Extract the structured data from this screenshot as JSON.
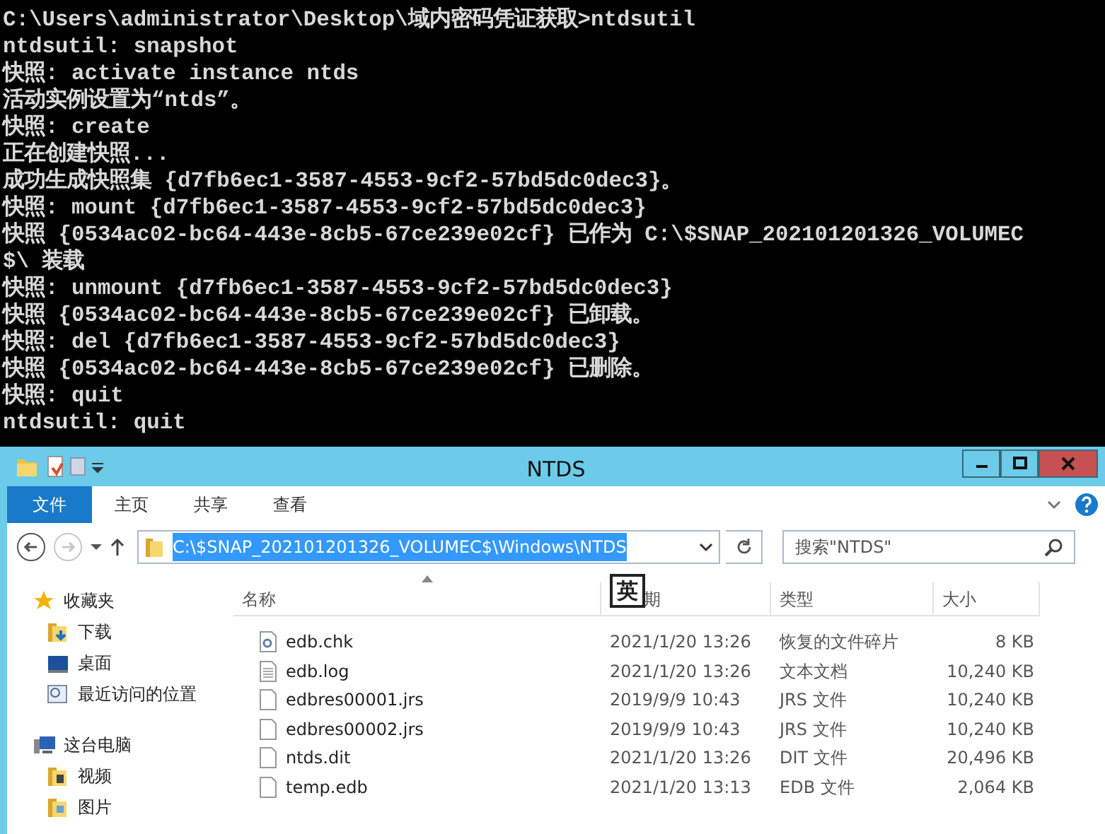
{
  "console": {
    "lines": [
      "C:\\Users\\administrator\\Desktop\\域内密码凭证获取>ntdsutil",
      "ntdsutil: snapshot",
      "快照: activate instance ntds",
      "活动实例设置为“ntds”。",
      "快照: create",
      "正在创建快照...",
      "成功生成快照集 {d7fb6ec1-3587-4553-9cf2-57bd5dc0dec3}。",
      "快照: mount {d7fb6ec1-3587-4553-9cf2-57bd5dc0dec3}",
      "快照 {0534ac02-bc64-443e-8cb5-67ce239e02cf} 已作为 C:\\$SNAP_202101201326_VOLUMEC",
      "$\\ 装载",
      "快照: unmount {d7fb6ec1-3587-4553-9cf2-57bd5dc0dec3}",
      "快照 {0534ac02-bc64-443e-8cb5-67ce239e02cf} 已卸载。",
      "快照: del {d7fb6ec1-3587-4553-9cf2-57bd5dc0dec3}",
      "快照 {0534ac02-bc64-443e-8cb5-67ce239e02cf} 已删除。",
      "快照: quit",
      "ntdsutil: quit"
    ]
  },
  "explorer": {
    "title": "NTDS",
    "ribbon_tabs": [
      {
        "label": "文件",
        "kind": "menu"
      },
      {
        "label": "主页",
        "kind": "tab"
      },
      {
        "label": "共享",
        "kind": "tab"
      },
      {
        "label": "查看",
        "kind": "tab"
      }
    ],
    "back": {
      "disabled": false
    },
    "forward": {
      "disabled": true
    },
    "address": {
      "path": "C:\\$SNAP_202101201326_VOLUMEC$\\Windows\\NTDS",
      "selected": true
    },
    "search": {
      "placeholder": "搜索\"NTDS\""
    },
    "nav": [
      {
        "label": "收藏夹",
        "kind": "star",
        "children": [
          {
            "label": "下载",
            "kind": "download"
          },
          {
            "label": "桌面",
            "kind": "desktop"
          },
          {
            "label": "最近访问的位置",
            "kind": "recent"
          }
        ]
      },
      {
        "label": "这台电脑",
        "kind": "computer",
        "children": [
          {
            "label": "视频",
            "kind": "video"
          },
          {
            "label": "图片",
            "kind": "pictures"
          }
        ]
      }
    ],
    "columns": [
      {
        "label": "名称"
      },
      {
        "label": "期"
      },
      {
        "label": "类型"
      },
      {
        "label": "大小"
      }
    ],
    "ime_indicator": "英",
    "files": [
      {
        "name": "edb.chk",
        "modified": "2021/1/20 13:26",
        "type": "恢复的文件碎片",
        "size": "8 KB",
        "kind": "chk"
      },
      {
        "name": "edb.log",
        "modified": "2021/1/20 13:26",
        "type": "文本文档",
        "size": "10,240 KB",
        "kind": "text"
      },
      {
        "name": "edbres00001.jrs",
        "modified": "2019/9/9 10:43",
        "type": "JRS 文件",
        "size": "10,240 KB",
        "kind": "file"
      },
      {
        "name": "edbres00002.jrs",
        "modified": "2019/9/9 10:43",
        "type": "JRS 文件",
        "size": "10,240 KB",
        "kind": "file"
      },
      {
        "name": "ntds.dit",
        "modified": "2021/1/20 13:26",
        "type": "DIT 文件",
        "size": "20,496 KB",
        "kind": "file"
      },
      {
        "name": "temp.edb",
        "modified": "2021/1/20 13:13",
        "type": "EDB 文件",
        "size": "2,064 KB",
        "kind": "file"
      }
    ]
  }
}
